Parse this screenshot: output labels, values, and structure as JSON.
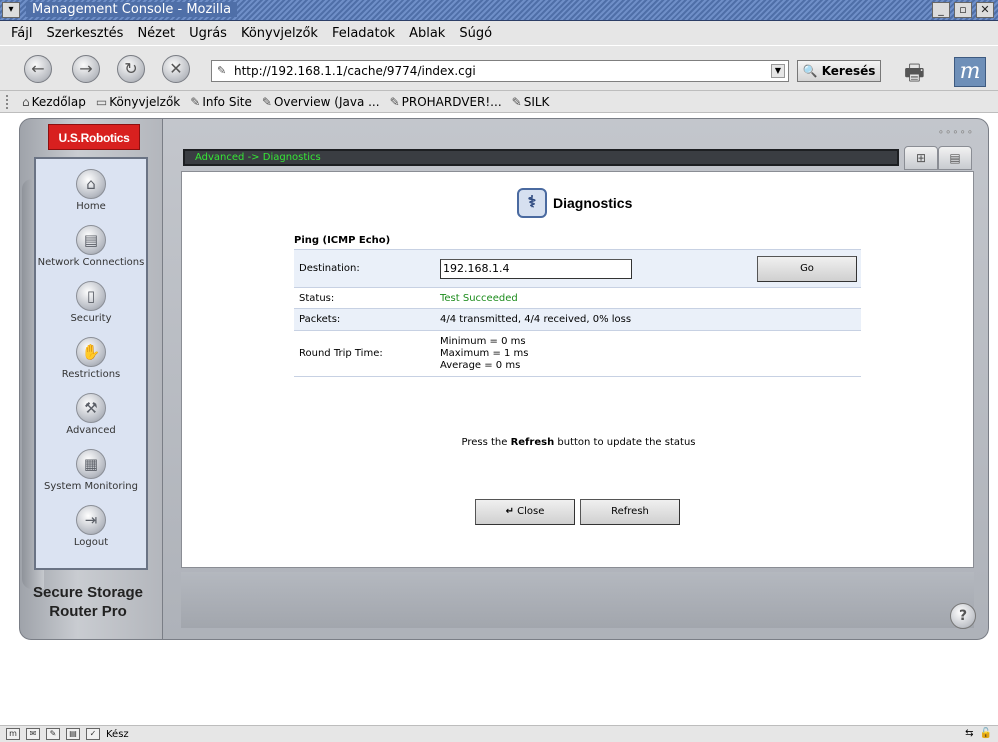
{
  "window": {
    "title": "Management Console - Mozilla",
    "menu_icon": "chevron-down-icon",
    "controls": [
      "_",
      "▫",
      "✕"
    ]
  },
  "menubar": [
    "Fájl",
    "Szerkesztés",
    "Nézet",
    "Ugrás",
    "Könyvjelzők",
    "Feladatok",
    "Ablak",
    "Súgó"
  ],
  "navbar": {
    "url": "http://192.168.1.1/cache/9774/index.cgi",
    "search_label": "Keresés",
    "logo_letter": "m"
  },
  "bookmarks": [
    {
      "label": "Kezdőlap",
      "icon": "home-icon",
      "glyph": "⌂"
    },
    {
      "label": "Könyvjelzők",
      "icon": "folder-icon",
      "glyph": "🗀"
    },
    {
      "label": "Info Site",
      "icon": "bookmark-icon",
      "glyph": "✎"
    },
    {
      "label": "Overview (Java ...",
      "icon": "bookmark-icon",
      "glyph": "✎"
    },
    {
      "label": "PROHARDVER!...",
      "icon": "bookmark-icon",
      "glyph": "✎"
    },
    {
      "label": "SILK",
      "icon": "bookmark-icon",
      "glyph": "✎"
    }
  ],
  "router": {
    "brand": "U.S.Robotics",
    "product_line1": "Secure Storage",
    "product_line2": "Router Pro",
    "breadcrumb": "Advanced -> Diagnostics",
    "nav": [
      {
        "label": "Home",
        "icon": "home-icon",
        "glyph": "⌂"
      },
      {
        "label": "Network Connections",
        "icon": "network-icon",
        "glyph": "▤"
      },
      {
        "label": "Security",
        "icon": "lock-icon",
        "glyph": "🔒"
      },
      {
        "label": "Restrictions",
        "icon": "restrictions-icon",
        "glyph": "✋"
      },
      {
        "label": "Advanced",
        "icon": "tools-icon",
        "glyph": "⚒"
      },
      {
        "label": "System Monitoring",
        "icon": "monitor-icon",
        "glyph": "▦"
      },
      {
        "label": "Logout",
        "icon": "logout-icon",
        "glyph": "⇥"
      }
    ]
  },
  "diagnostics": {
    "title": "Diagnostics",
    "section": "Ping (ICMP Echo)",
    "destination_label": "Destination:",
    "destination_value": "192.168.1.4",
    "go_label": "Go",
    "status_label": "Status:",
    "status_value": "Test Succeeded",
    "packets_label": "Packets:",
    "packets_value": "4/4 transmitted, 4/4 received, 0% loss",
    "rtt_label": "Round Trip Time:",
    "rtt_min": "Minimum = 0 ms",
    "rtt_max": "Maximum = 1 ms",
    "rtt_avg": "Average = 0 ms",
    "help_prefix": "Press the ",
    "help_bold": "Refresh",
    "help_suffix": " button to update the status",
    "close_label": "Close",
    "refresh_label": "Refresh"
  },
  "statusbar": {
    "text": "Kész"
  },
  "colors": {
    "brand_red": "#d8201f",
    "breadcrumb_green": "#35e635",
    "status_green": "#1c8c1c",
    "nav_bg": "#dbe3f2"
  }
}
